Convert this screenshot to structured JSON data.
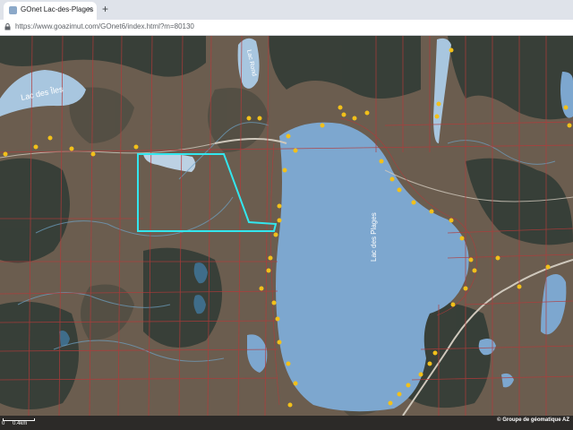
{
  "browser": {
    "tab_title": "GOnet Lac-des-Plages",
    "tab_close": "×",
    "new_tab": "+",
    "url": "https://www.goazimut.com/GOnet6/index.html?m=80130"
  },
  "map": {
    "labels": {
      "lac_des_iles": "Lac des Îles",
      "lac_des_plages": "Lac des Plages",
      "lac_small": "Lac Rond"
    },
    "colors": {
      "terrain": "#6b5d4f",
      "forest": "#2f3a34",
      "water": "#7da7cf",
      "cadastre": "#b33a3a",
      "selection": "#33e6ee",
      "marker": "#f2c01a"
    }
  },
  "scale": {
    "zero": "0",
    "distance": "0.4km"
  },
  "copyright": "© Groupe de géomatique AZ"
}
